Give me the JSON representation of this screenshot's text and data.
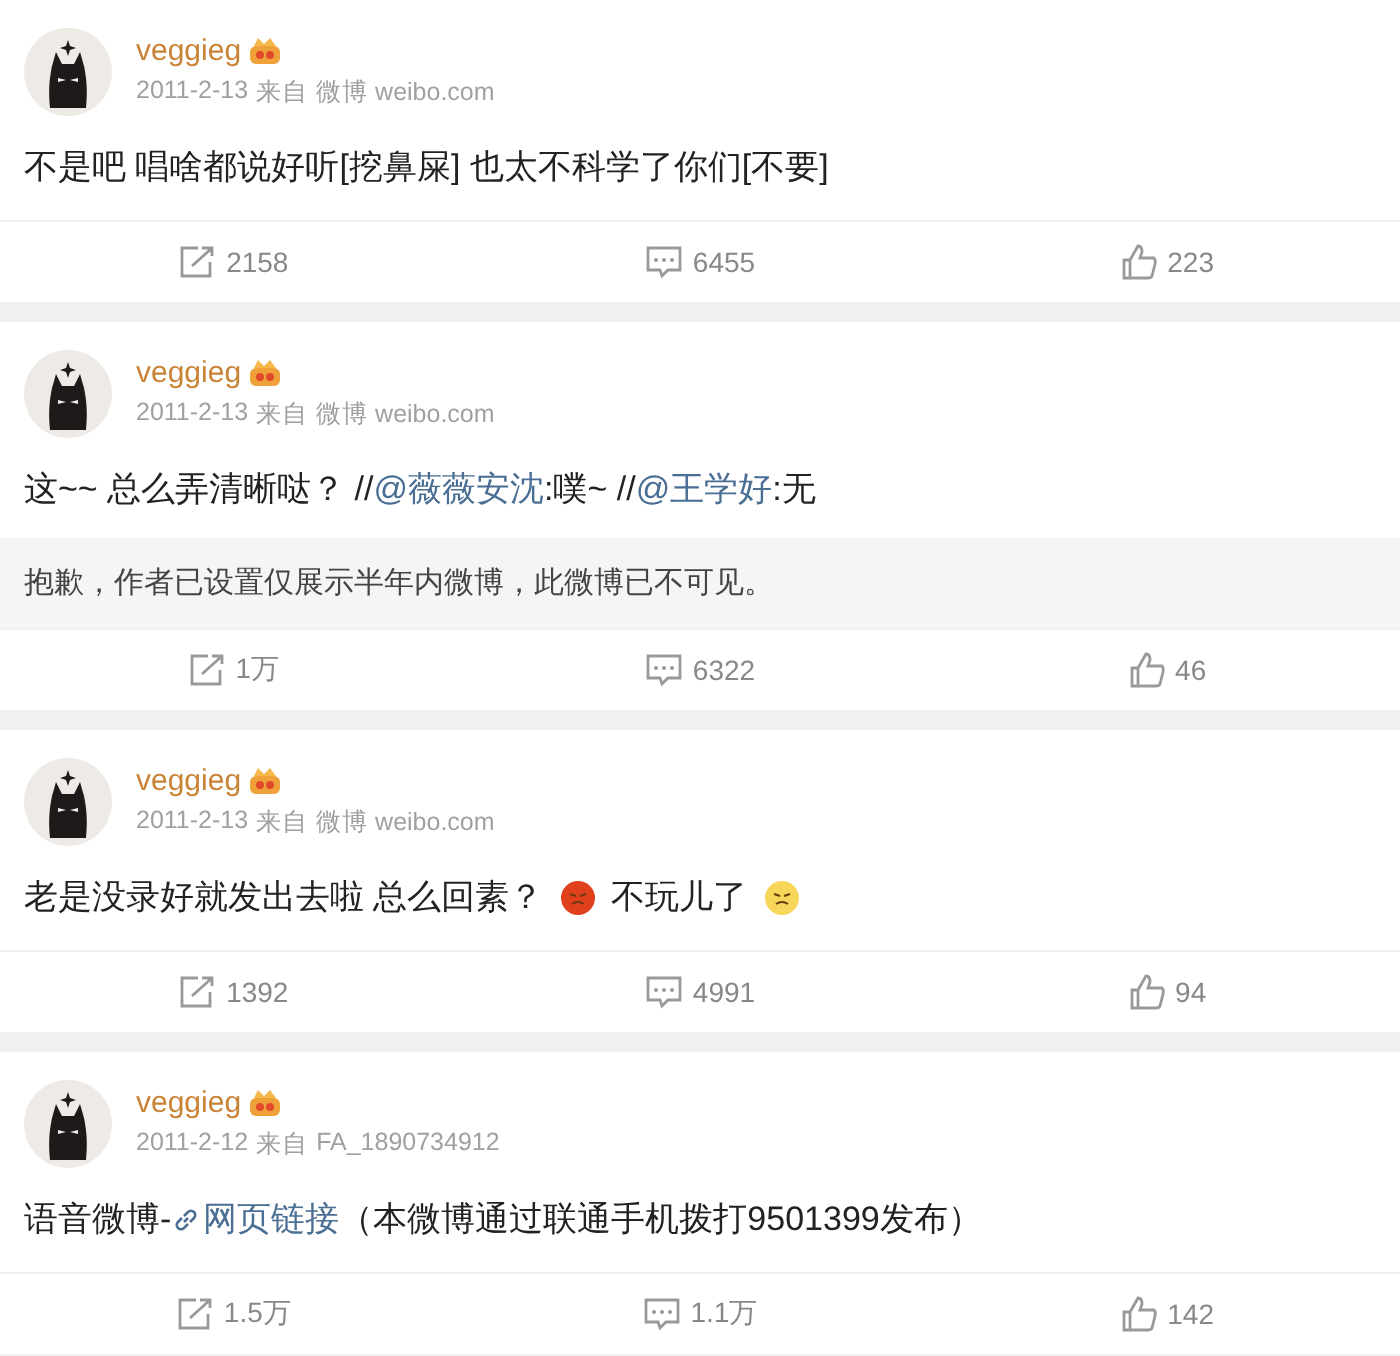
{
  "posts": [
    {
      "user": "veggieg",
      "date": "2011-2-13",
      "source_label": "来自",
      "source": "微博 weibo.com",
      "content": [
        {
          "kind": "text",
          "text": "不是吧 唱啥都说好听[挖鼻屎] 也太不科学了你们[不要]"
        }
      ],
      "reposts": "2158",
      "comments": "6455",
      "likes": "223"
    },
    {
      "user": "veggieg",
      "date": "2011-2-13",
      "source_label": "来自",
      "source": "微博 weibo.com",
      "content": [
        {
          "kind": "text",
          "text": "这~~ 总么弄清晰哒？ //"
        },
        {
          "kind": "mention",
          "text": "@薇薇安沈"
        },
        {
          "kind": "text",
          "text": ":噗~ //"
        },
        {
          "kind": "mention",
          "text": "@王学好"
        },
        {
          "kind": "text",
          "text": ":无"
        }
      ],
      "notice": "抱歉，作者已设置仅展示半年内微博，此微博已不可见。",
      "reposts": "1万",
      "comments": "6322",
      "likes": "46"
    },
    {
      "user": "veggieg",
      "date": "2011-2-13",
      "source_label": "来自",
      "source": "微博 weibo.com",
      "content": [
        {
          "kind": "text",
          "text": "老是没录好就发出去啦 总么回素？"
        },
        {
          "kind": "emoji",
          "color": "#e0401c"
        },
        {
          "kind": "text",
          "text": "不玩儿了"
        },
        {
          "kind": "emoji",
          "color": "#f7d65a"
        }
      ],
      "reposts": "1392",
      "comments": "4991",
      "likes": "94"
    },
    {
      "user": "veggieg",
      "date": "2011-2-12",
      "source_label": "来自",
      "source": "FA_1890734912",
      "content": [
        {
          "kind": "text",
          "text": "语音微博-"
        },
        {
          "kind": "link",
          "text": "网页链接"
        },
        {
          "kind": "text",
          "text": "（本微博通过联通手机拨打9501399发布）"
        }
      ],
      "reposts": "1.5万",
      "comments": "1.1万",
      "likes": "142"
    }
  ]
}
